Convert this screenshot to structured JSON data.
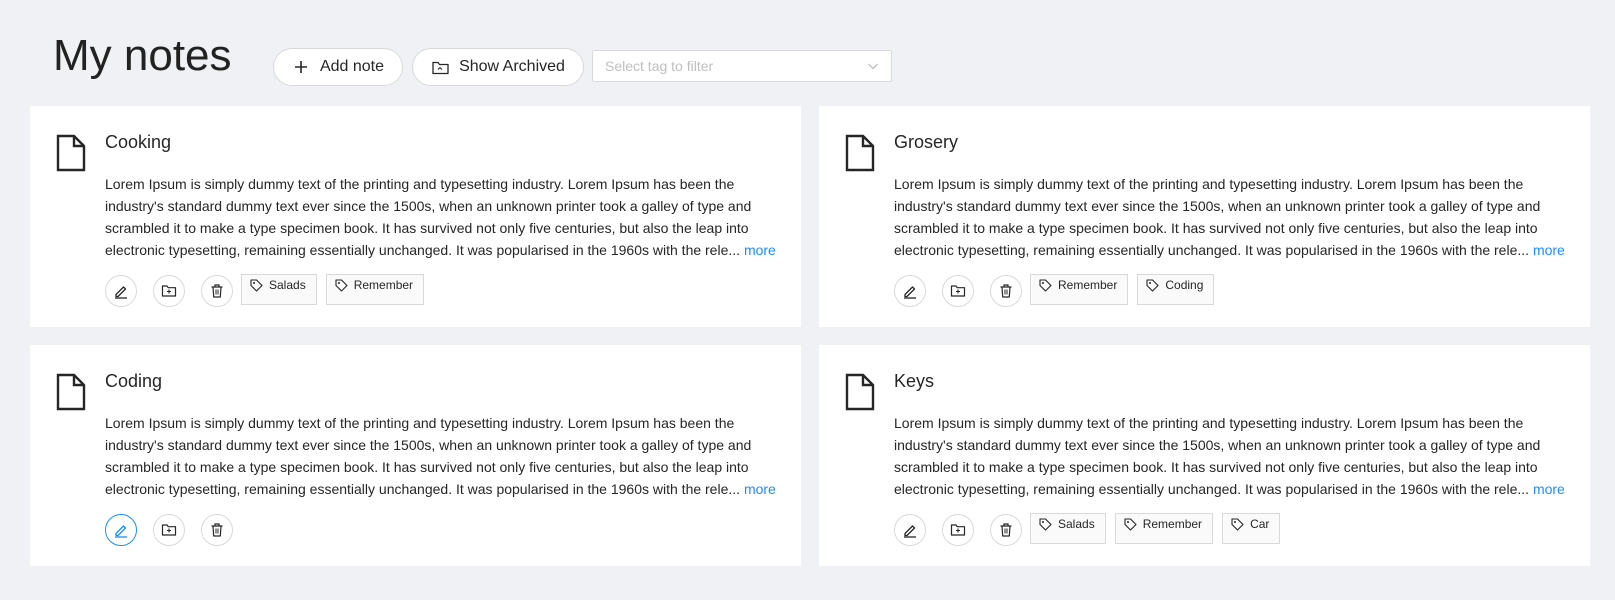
{
  "header": {
    "title": "My notes",
    "add_note_label": "Add note",
    "show_archived_label": "Show Archived",
    "tag_filter_placeholder": "Select tag to filter"
  },
  "notes": [
    {
      "title": "Cooking",
      "body": "Lorem Ipsum is simply dummy text of the printing and typesetting industry. Lorem Ipsum has been the industry's standard dummy text ever since the 1500s, when an unknown printer took a galley of type and scrambled it to make a type specimen book. It has survived not only five centuries, but also the leap into electronic typesetting, remaining essentially unchanged. It was popularised in the 1960s with the rele...",
      "more_label": "more",
      "tags": [
        "Salads",
        "Remember"
      ],
      "edit_active": false
    },
    {
      "title": "Grosery",
      "body": "Lorem Ipsum is simply dummy text of the printing and typesetting industry. Lorem Ipsum has been the industry's standard dummy text ever since the 1500s, when an unknown printer took a galley of type and scrambled it to make a type specimen book. It has survived not only five centuries, but also the leap into electronic typesetting, remaining essentially unchanged. It was popularised in the 1960s with the rele...",
      "more_label": "more",
      "tags": [
        "Remember",
        "Coding"
      ],
      "edit_active": false
    },
    {
      "title": "Coding",
      "body": "Lorem Ipsum is simply dummy text of the printing and typesetting industry. Lorem Ipsum has been the industry's standard dummy text ever since the 1500s, when an unknown printer took a galley of type and scrambled it to make a type specimen book. It has survived not only five centuries, but also the leap into electronic typesetting, remaining essentially unchanged. It was popularised in the 1960s with the rele...",
      "more_label": "more",
      "tags": [],
      "edit_active": true
    },
    {
      "title": "Keys",
      "body": "Lorem Ipsum is simply dummy text of the printing and typesetting industry. Lorem Ipsum has been the industry's standard dummy text ever since the 1500s, when an unknown printer took a galley of type and scrambled it to make a type specimen book. It has survived not only five centuries, but also the leap into electronic typesetting, remaining essentially unchanged. It was popularised in the 1960s with the rele...",
      "more_label": "more",
      "tags": [
        "Salads",
        "Remember",
        "Car"
      ],
      "edit_active": false
    }
  ],
  "icons": {
    "add": "plus-icon",
    "archive": "folder-icon",
    "select": "chevron-down-icon",
    "note": "file-icon",
    "edit": "edit-icon",
    "archive_note": "folder-add-icon",
    "delete": "delete-icon",
    "tag": "tag-icon"
  },
  "colors": {
    "background": "#f0f1f4",
    "card": "#ffffff",
    "accent": "#1890ff",
    "border": "#d9d9d9",
    "placeholder": "#bfbfbf"
  }
}
